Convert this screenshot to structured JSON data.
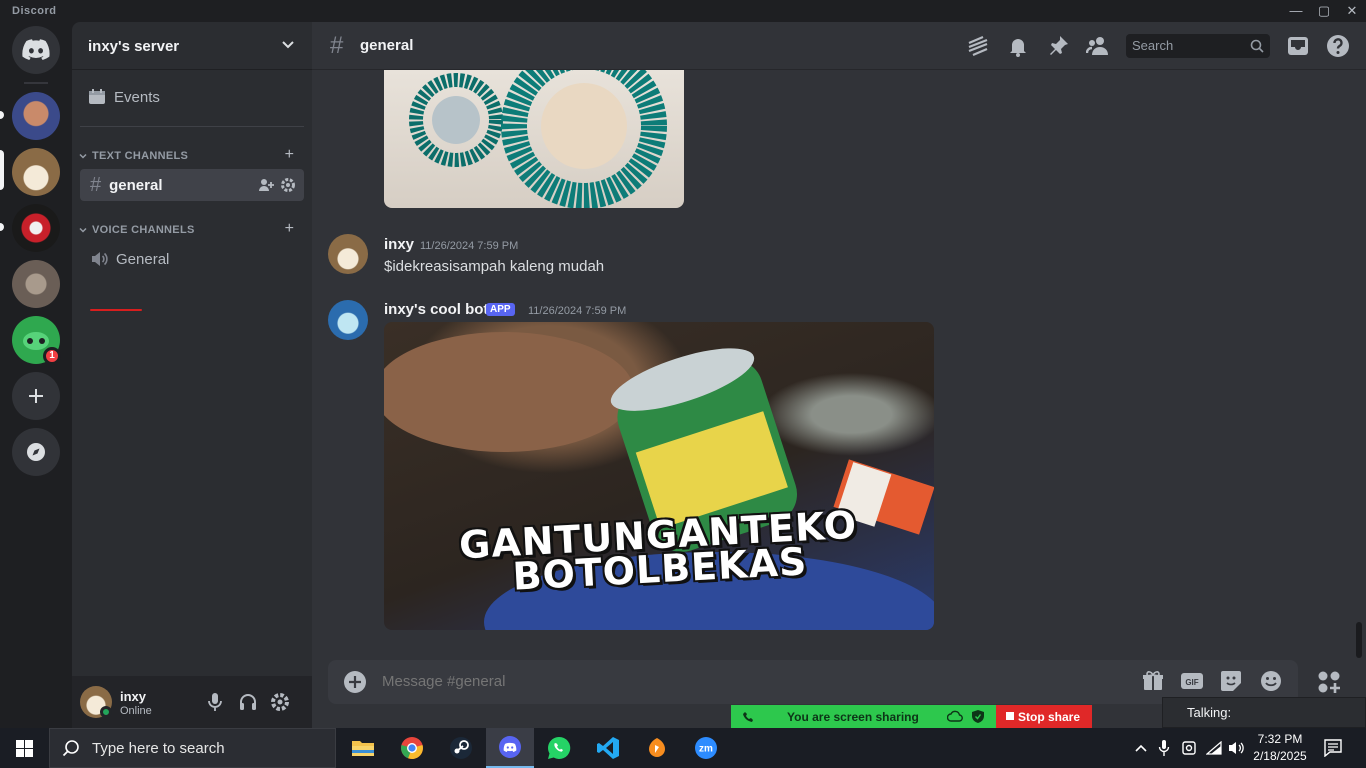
{
  "window": {
    "title": "Discord",
    "controls": [
      "—",
      "▢",
      "✕"
    ]
  },
  "server_rail": {
    "notification_count": "1"
  },
  "sidebar": {
    "server_name": "inxy's server",
    "events_label": "Events",
    "text_category": "TEXT CHANNELS",
    "voice_category": "VOICE CHANNELS",
    "text_channels": [
      {
        "name": "general",
        "active": true
      }
    ],
    "voice_channels": [
      {
        "name": "General"
      }
    ]
  },
  "user_panel": {
    "username": "inxy",
    "status": "Online",
    "status_color": "#23a55a"
  },
  "header": {
    "channel_name": "general",
    "search_placeholder": "Search"
  },
  "messages": [
    {
      "author": "inxy",
      "timestamp": "11/26/2024 7:59 PM",
      "text": "$idekreasisampah kaleng mudah"
    },
    {
      "author": "inxy's cool bot",
      "badge": "APP",
      "timestamp": "11/26/2024 7:59 PM",
      "image_caption_line1": "GANTUNGANTEKO",
      "image_caption_line2": "BOTOLBEKAS"
    }
  ],
  "composer": {
    "placeholder": "Message #general"
  },
  "screen_share": {
    "status": "You are screen sharing",
    "stop_label": "Stop share",
    "talking_label": "Talking:"
  },
  "taskbar": {
    "search_placeholder": "Type here to search",
    "time": "7:32 PM",
    "date": "2/18/2025"
  },
  "colors": {
    "accent": "#5865f2",
    "background": "#313338",
    "sidebar": "#2b2d31",
    "rail": "#1e1f22",
    "danger": "#f23f43",
    "share_green": "#2dc84d"
  }
}
